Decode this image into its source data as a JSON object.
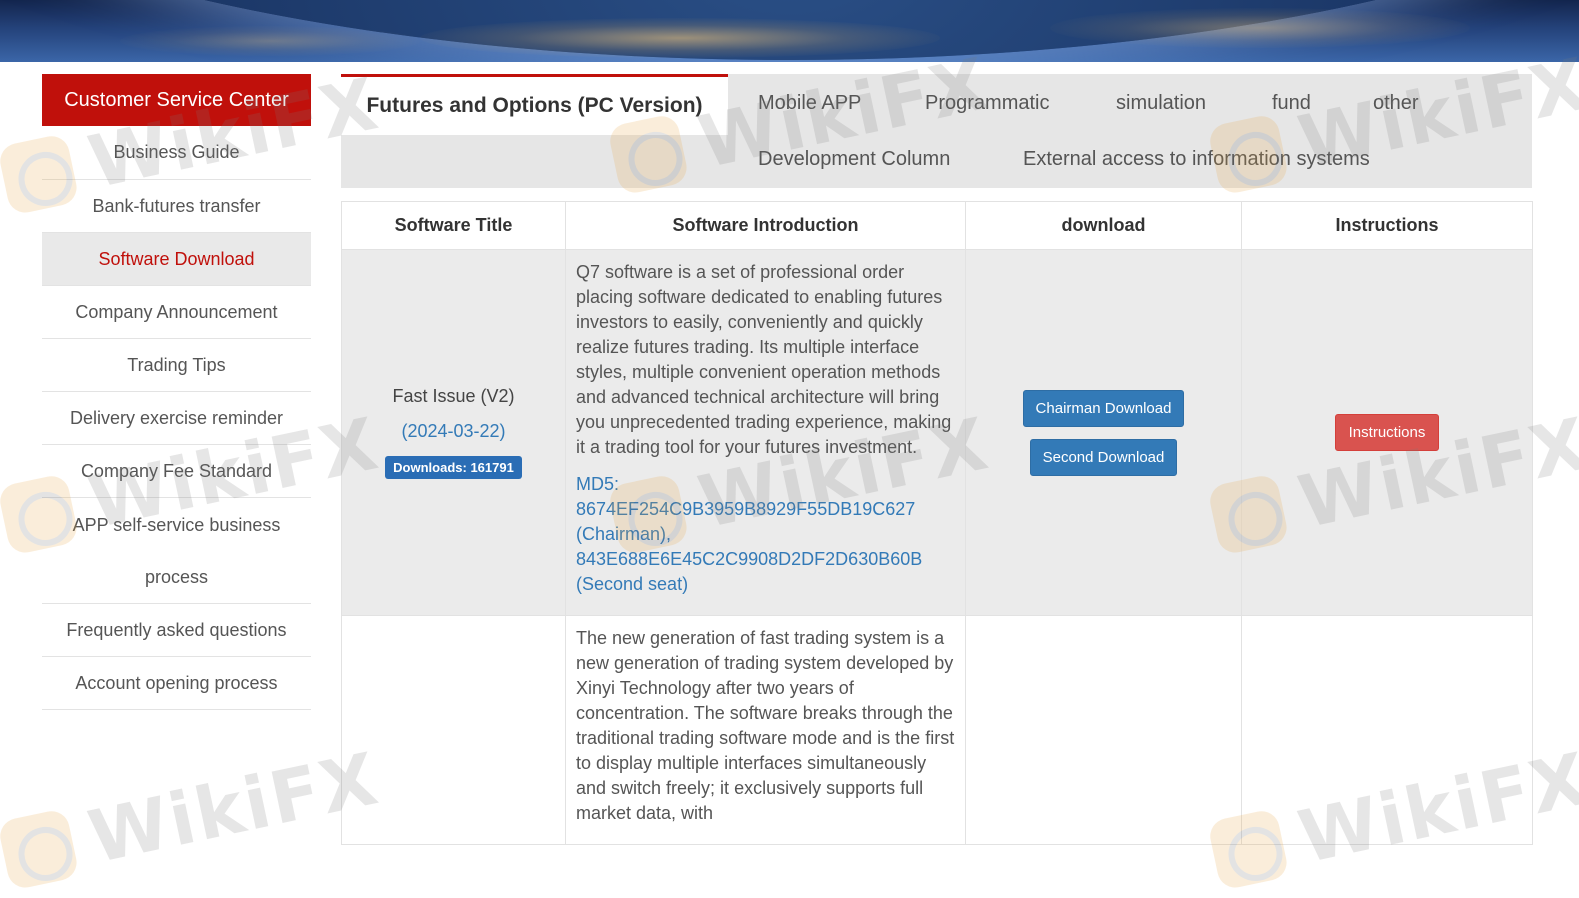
{
  "sidebar": {
    "header": "Customer Service Center",
    "items": [
      {
        "label": "Business Guide"
      },
      {
        "label": "Bank-futures transfer"
      },
      {
        "label": "Software Download"
      },
      {
        "label": "Company Announcement"
      },
      {
        "label": "Trading Tips"
      },
      {
        "label": "Delivery exercise reminder"
      },
      {
        "label": "Company Fee Standard"
      },
      {
        "label": "APP self-service business process"
      },
      {
        "label": "Frequently asked questions"
      },
      {
        "label": "Account opening process"
      }
    ],
    "active_item": "Software Download"
  },
  "tabs": {
    "active": "Futures and Options (PC Version)",
    "items": [
      {
        "label": "Futures and Options (PC Version)"
      },
      {
        "label": "Mobile APP"
      },
      {
        "label": "Programmatic"
      },
      {
        "label": "simulation"
      },
      {
        "label": "fund"
      },
      {
        "label": "other"
      },
      {
        "label": "Development Column"
      },
      {
        "label": "External access to information systems"
      }
    ]
  },
  "table": {
    "headers": [
      "Software Title",
      "Software Introduction",
      "download",
      "Instructions"
    ],
    "rows": [
      {
        "title": "Fast Issue (V2)",
        "date": "(2024-03-22)",
        "downloads": "Downloads: 161791",
        "intro": "Q7 software is a set of professional order placing software dedicated to enabling futures investors to easily, conveniently and quickly realize futures trading. Its multiple interface styles, multiple convenient operation methods and advanced technical architecture will bring you unprecedented trading experience, making it a trading tool for your futures investment.",
        "md5": "MD5: 8674EF254C9B3959B8929F55DB19C627 (Chairman), 843E688E6E45C2C9908D2DF2D630B60B (Second seat)",
        "download_primary": "Chairman Download",
        "download_secondary": "Second Download",
        "instructions": "Instructions"
      },
      {
        "intro": "The new generation of fast trading system is a new generation of trading system developed by Xinyi Technology after two years of concentration. The software breaks through the traditional trading software mode and is the first to display multiple interfaces simultaneously and switch freely; it exclusively supports full market data, with"
      }
    ]
  },
  "watermark": {
    "text": "WikiFX"
  },
  "colors": {
    "brand_red": "#c0100b",
    "link_blue": "#337ab7",
    "button_blue": "#337ab7",
    "button_red": "#d9534f",
    "badge_blue": "#2a6db5",
    "row_gray": "#ebebeb"
  }
}
